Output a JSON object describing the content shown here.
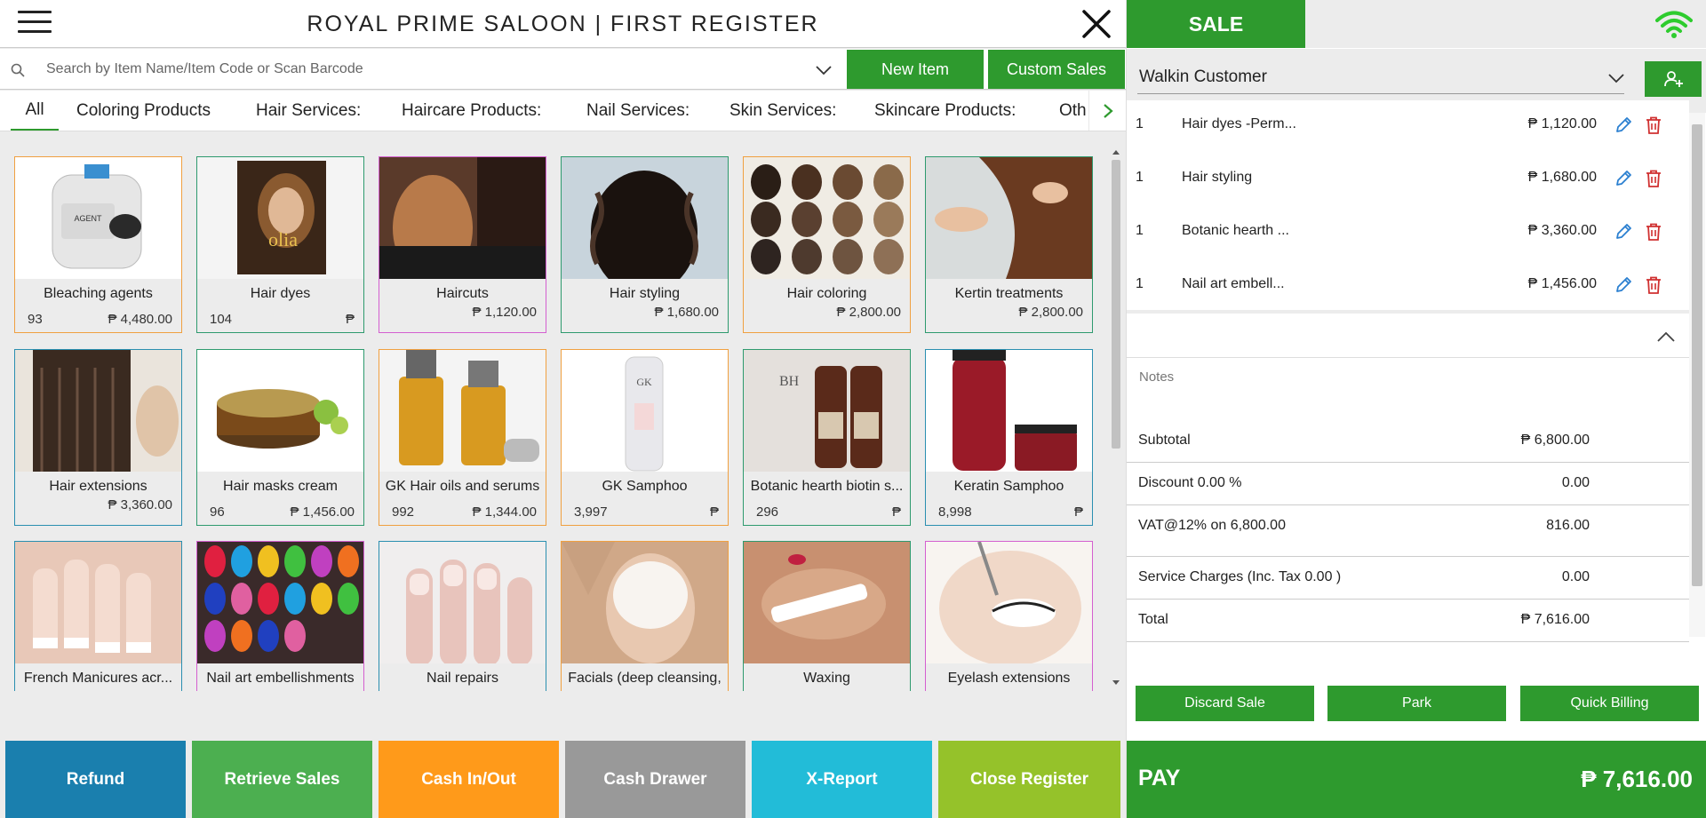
{
  "header": {
    "title": "ROYAL PRIME SALOON | FIRST REGISTER"
  },
  "search": {
    "placeholder": "Search by Item Name/Item Code or Scan Barcode",
    "new_item_label": "New Item",
    "custom_sales_label": "Custom Sales"
  },
  "categories": [
    "All",
    "Coloring Products",
    "Hair Services:",
    "Haircare Products:",
    "Nail Services:",
    "Skin Services:",
    "Skincare Products:",
    "Oth"
  ],
  "products": [
    {
      "name": "Bleaching agents",
      "qty": "93",
      "price": "₱ 4,480.00",
      "border": "#f0a040",
      "image": "bleaching-agent-jug"
    },
    {
      "name": "Hair dyes",
      "qty": "104",
      "price": "₱",
      "border": "#2e9a6e",
      "image": "hair-dye-box"
    },
    {
      "name": "Haircuts",
      "qty": "",
      "price": "₱ 1,120.00",
      "border": "#d45fd0",
      "image": "haircut-photo"
    },
    {
      "name": "Hair styling",
      "qty": "",
      "price": "₱ 1,680.00",
      "border": "#2e9a6e",
      "image": "curly-hair-photo"
    },
    {
      "name": "Hair coloring",
      "qty": "",
      "price": "₱ 2,800.00",
      "border": "#f0a040",
      "image": "hair-color-swatches"
    },
    {
      "name": "Kertin treatments",
      "qty": "",
      "price": "₱ 2,800.00",
      "border": "#2e9a6e",
      "image": "keratin-treatment-photo"
    },
    {
      "name": "Hair extensions",
      "qty": "",
      "price": "₱ 3,360.00",
      "border": "#2a8fb0",
      "image": "hair-extensions-photo"
    },
    {
      "name": "Hair masks cream",
      "qty": "96",
      "price": "₱ 1,456.00",
      "border": "#2e9a6e",
      "image": "hair-mask-jar"
    },
    {
      "name": "GK Hair oils and serums",
      "qty": "992",
      "price": "₱ 1,344.00",
      "border": "#f0a040",
      "image": "gk-oil-bottles"
    },
    {
      "name": "GK Samphoo",
      "qty": "3,997",
      "price": "₱",
      "border": "#f0a040",
      "image": "gk-shampoo-bottle"
    },
    {
      "name": "Botanic hearth biotin s...",
      "qty": "296",
      "price": "₱",
      "border": "#2e9a6e",
      "image": "biotin-bottles"
    },
    {
      "name": "Keratin Samphoo",
      "qty": "8,998",
      "price": "₱",
      "border": "#2a8fb0",
      "image": "tresemme-bottles"
    },
    {
      "name": "French Manicures acr...",
      "qty": "",
      "price": "",
      "border": "#2a8fb0",
      "image": "french-manicure-photo"
    },
    {
      "name": "Nail art embellishments",
      "qty": "",
      "price": "",
      "border": "#d45fd0",
      "image": "nail-art-photo"
    },
    {
      "name": "Nail repairs",
      "qty": "",
      "price": "",
      "border": "#2a8fb0",
      "image": "nail-repair-photo"
    },
    {
      "name": "Facials (deep cleansing,",
      "qty": "",
      "price": "",
      "border": "#f0a040",
      "image": "facial-mask-photo"
    },
    {
      "name": "Waxing",
      "qty": "",
      "price": "",
      "border": "#2e9a6e",
      "image": "waxing-photo"
    },
    {
      "name": "Eyelash extensions",
      "qty": "",
      "price": "",
      "border": "#d45fd0",
      "image": "eyelash-photo"
    }
  ],
  "bottom_buttons": [
    {
      "label": "Refund",
      "color": "#1a7fae"
    },
    {
      "label": "Retrieve Sales",
      "color": "#4caf50"
    },
    {
      "label": "Cash In/Out",
      "color": "#ff9a1a"
    },
    {
      "label": "Cash Drawer",
      "color": "#999999"
    },
    {
      "label": "X-Report",
      "color": "#22bcd8"
    },
    {
      "label": "Close Register",
      "color": "#95c22a"
    }
  ],
  "sale": {
    "tab_label": "SALE",
    "customer": "Walkin Customer",
    "cart": [
      {
        "qty": "1",
        "name": "Hair dyes -Perm...",
        "price": "₱ 1,120.00"
      },
      {
        "qty": "1",
        "name": "Hair styling",
        "price": "₱ 1,680.00"
      },
      {
        "qty": "1",
        "name": "Botanic hearth ...",
        "price": "₱ 3,360.00"
      },
      {
        "qty": "1",
        "name": "Nail art embell...",
        "price": "₱ 1,456.00"
      }
    ],
    "notes_placeholder": "Notes",
    "summary": [
      {
        "label": "Subtotal",
        "value": "₱ 6,800.00"
      },
      {
        "label": "Discount 0.00 %",
        "value": "0.00"
      },
      {
        "label": "VAT@12% on 6,800.00",
        "value": "816.00"
      },
      {
        "label": "Service Charges (Inc. Tax 0.00 )",
        "value": "0.00"
      },
      {
        "label": "Total",
        "value": "₱ 7,616.00"
      }
    ],
    "discard_label": "Discard Sale",
    "park_label": "Park",
    "quick_billing_label": "Quick Billing",
    "pay_label": "PAY",
    "pay_amount": "₱ 7,616.00"
  },
  "colors": {
    "brand_green": "#2e9a2e"
  }
}
